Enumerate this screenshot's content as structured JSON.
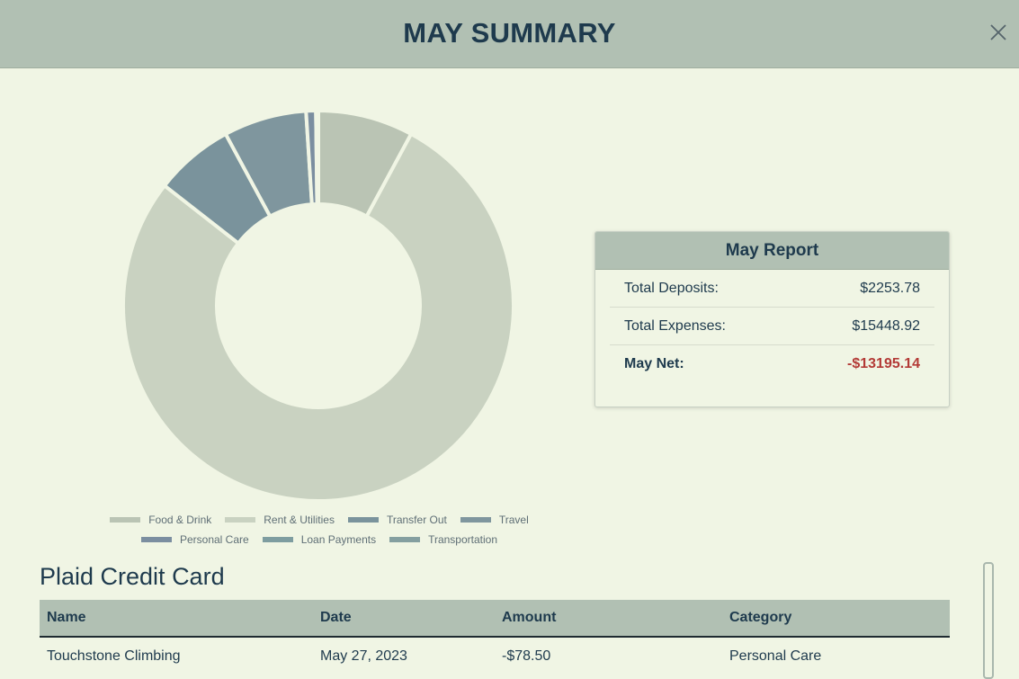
{
  "header": {
    "title": "MAY SUMMARY",
    "close_icon": "close-icon"
  },
  "chart_data": {
    "type": "pie",
    "categories": [
      "Food & Drink",
      "Rent & Utilities",
      "Transfer Out",
      "Travel",
      "Personal Care",
      "Loan Payments",
      "Transportation"
    ],
    "values": [
      7.8,
      76.9,
      6.5,
      6.8,
      0.8,
      0.1,
      0.1
    ],
    "colors": [
      "#bac4b4",
      "#c9d2c1",
      "#7a939c",
      "#7f969e",
      "#7b8ea0",
      "#7e9da0",
      "#849fa0"
    ],
    "legend_placement": "bottom",
    "title": ""
  },
  "report": {
    "title": "May Report",
    "rows": [
      {
        "label": "Total Deposits:",
        "value": "$2253.78"
      },
      {
        "label": "Total Expenses:",
        "value": "$15448.92"
      },
      {
        "label": "May Net:",
        "value": "-$13195.14"
      }
    ]
  },
  "account": {
    "title": "Plaid Credit Card",
    "columns": [
      "Name",
      "Date",
      "Amount",
      "Category"
    ],
    "rows": [
      [
        "Touchstone Climbing",
        "May 27, 2023",
        "-$78.50",
        "Personal Care"
      ]
    ]
  }
}
